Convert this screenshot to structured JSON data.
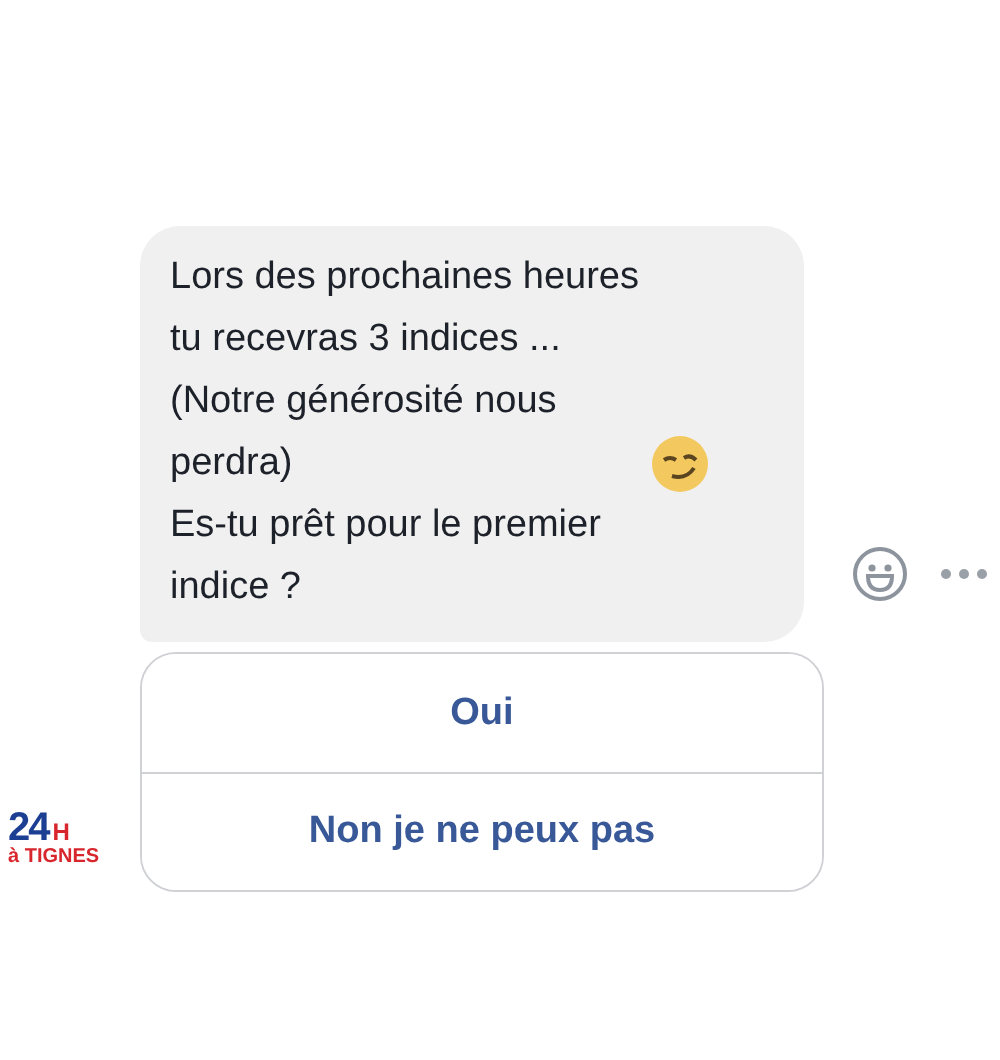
{
  "message": {
    "text_before": "Lors des prochaines heures\ntu recevras 3 indices ...\n(Notre générosité nous\nperdra)",
    "text_after": "Es-tu prêt pour le premier\nindice ?"
  },
  "quick_replies": [
    {
      "label": "Oui"
    },
    {
      "label": "Non je ne peux pas"
    }
  ],
  "sender_logo": {
    "number": "24",
    "letter": "H",
    "place": "à TIGNES"
  }
}
